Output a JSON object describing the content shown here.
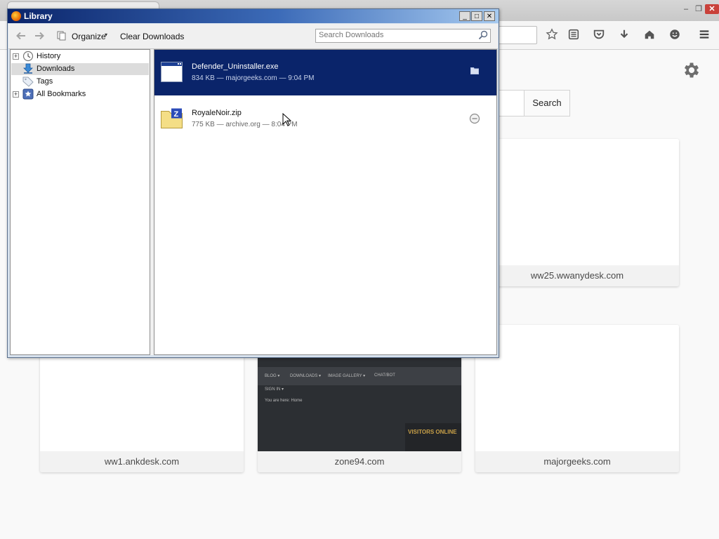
{
  "firefox": {
    "window_controls": {
      "minimize": "–",
      "restore": "❐",
      "close": "✕"
    },
    "toolbar_icons": [
      "star-icon",
      "reading-list-icon",
      "pocket-icon",
      "download-arrow-icon",
      "home-icon",
      "hello-icon",
      "hamburger-menu-icon"
    ],
    "search_button": "Search",
    "tiles": [
      {
        "caption": "ww25.wwanydesk.com"
      },
      {
        "caption": "ww1.ankdesk.com"
      },
      {
        "caption": "zone94.com",
        "thumb_text": {
          "nav1": "BLOG ▾",
          "nav2": "DOWNLOADS ▾",
          "nav3": "IMAGE GALLERY ▾",
          "nav4": "CHAT/BOT",
          "sub": "SIGN IN ▾",
          "path": "You are here: Home",
          "visitors": "VISITORS ONLINE"
        }
      },
      {
        "caption": "majorgeeks.com"
      }
    ]
  },
  "library": {
    "title": "Library",
    "window_controls": {
      "minimize": "_",
      "maximize": "□",
      "close": "✕"
    },
    "toolbar": {
      "organize": "Organize",
      "organize_caret": "▾",
      "clear_downloads": "Clear Downloads",
      "search_placeholder": "Search Downloads"
    },
    "sidebar": [
      {
        "label": "History",
        "icon": "clock-icon",
        "expandable": true
      },
      {
        "label": "Downloads",
        "icon": "download-icon",
        "expandable": false,
        "selected": true
      },
      {
        "label": "Tags",
        "icon": "tag-icon",
        "expandable": false
      },
      {
        "label": "All Bookmarks",
        "icon": "bookmarks-icon",
        "expandable": true
      }
    ],
    "downloads": [
      {
        "name": "Defender_Uninstaller.exe",
        "meta": "834 KB — majorgeeks.com — 9:04 PM",
        "icon": "exe-file-icon",
        "action_icon": "open-folder-icon",
        "selected": true
      },
      {
        "name": "RoyaleNoir.zip",
        "meta": "775 KB — archive.org — 8:04 PM",
        "icon": "zip-file-icon",
        "action_icon": "retry-icon",
        "selected": false
      }
    ]
  },
  "colors": {
    "selection": "#0a246a",
    "titlebar_start": "#0a246a",
    "titlebar_end": "#a6caf0",
    "firefox_close": "#c9413a"
  }
}
